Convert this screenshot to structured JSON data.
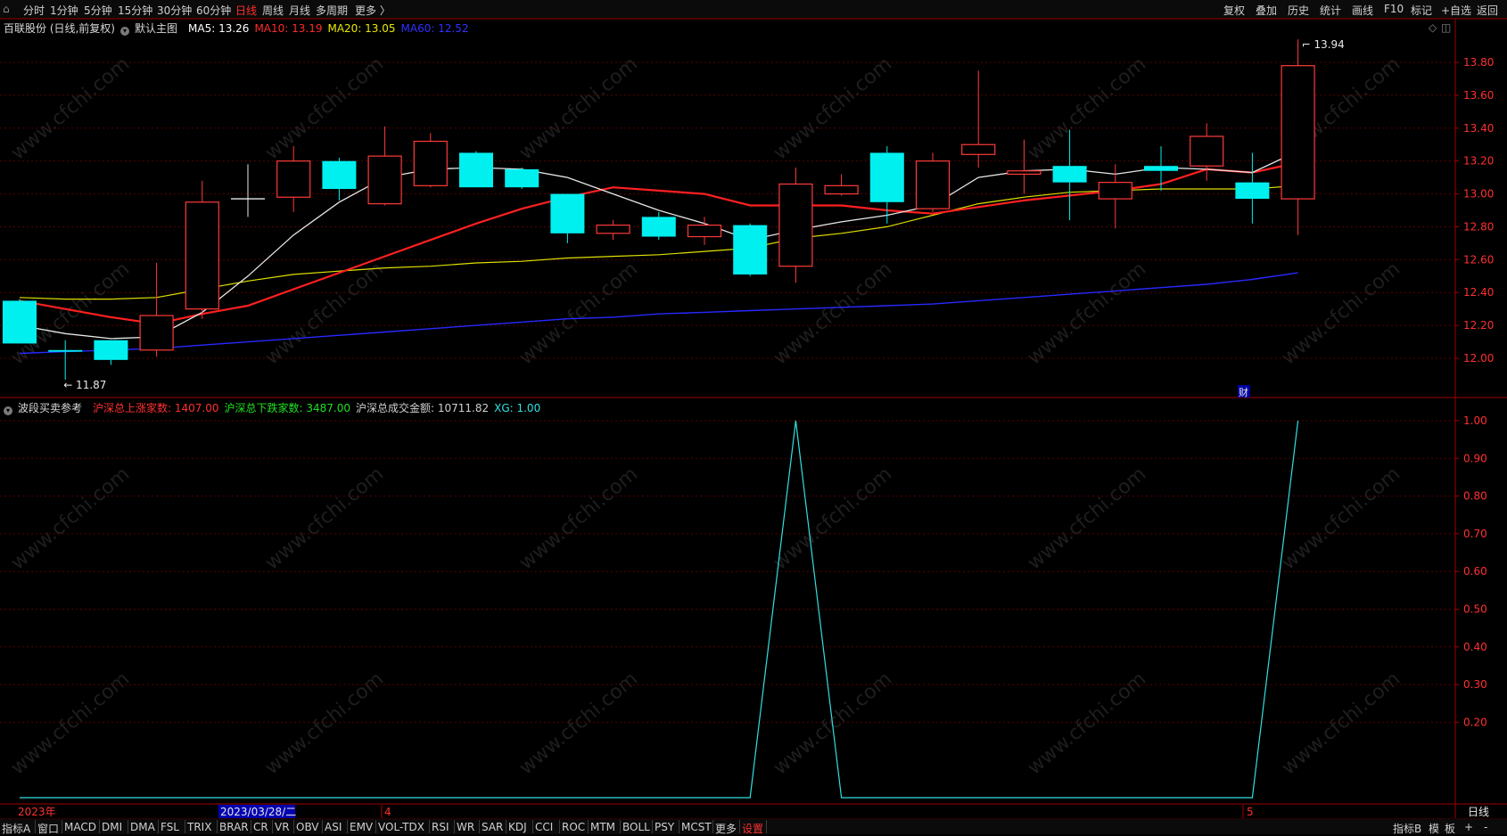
{
  "toolbar": {
    "back_arrow": "⌂",
    "periods": [
      "分时",
      "1分钟",
      "5分钟",
      "15分钟",
      "30分钟",
      "60分钟",
      "日线",
      "周线",
      "月线",
      "多周期",
      "更多 〉"
    ],
    "active_period": "日线",
    "right_tools": [
      "复权",
      "叠加",
      "历史",
      "统计",
      "画线",
      "F10",
      "标记",
      "+自选",
      "返回"
    ]
  },
  "main_panel": {
    "title": "百联股份 (日线,前复权)",
    "template_label": "默认主图",
    "ma_legend": [
      {
        "label": "MA5: 13.26",
        "color": "#ffffff"
      },
      {
        "label": "MA10: 13.19",
        "color": "#ff2a2a"
      },
      {
        "label": "MA20: 13.05",
        "color": "#e8e800"
      },
      {
        "label": "MA60: 12.52",
        "color": "#3030ff"
      }
    ],
    "high_label": "13.94",
    "low_label": "11.87",
    "fin_badge": "财",
    "y_ticks": [
      "13.80",
      "13.60",
      "13.40",
      "13.20",
      "13.00",
      "12.80",
      "12.60",
      "12.40",
      "12.20",
      "12.00"
    ],
    "corner_icons": [
      "◇",
      "◫"
    ]
  },
  "sub_panel": {
    "title": "波段买卖参考",
    "stats": [
      {
        "label": "沪深总上涨家数: 1407.00",
        "color": "#ff3030"
      },
      {
        "label": "沪深总下跌家数: 3487.00",
        "color": "#20e020"
      },
      {
        "label": "沪深总成交金额: 10711.82",
        "color": "#d0d0d0"
      },
      {
        "label": "XG: 1.00",
        "color": "#30e0e0"
      }
    ],
    "y_ticks": [
      "1.00",
      "0.90",
      "0.80",
      "0.70",
      "0.60",
      "0.50",
      "0.40",
      "0.30",
      "0.20"
    ]
  },
  "x_axis": {
    "labels": [
      "2023年",
      "2023/03/28/二",
      "4",
      "5"
    ],
    "cursor_label": "2023/03/28/二",
    "period_label": "日线"
  },
  "watermark": "www.cfchi.com",
  "bottom_bar": {
    "items": [
      "指标A",
      "窗口",
      "MACD",
      "DMI",
      "DMA",
      "FSL",
      "TRIX",
      "BRAR",
      "CR",
      "VR",
      "OBV",
      "ASI",
      "EMV",
      "VOL-TDX",
      "RSI",
      "WR",
      "SAR",
      "KDJ",
      "CCI",
      "ROC",
      "MTM",
      "BOLL",
      "PSY",
      "MCST",
      "更多",
      "设置"
    ],
    "right_items": [
      "指标B",
      "模",
      "板",
      "+",
      "-"
    ]
  },
  "chart_data": [
    {
      "type": "candlestick",
      "y_range": [
        11.8,
        13.95
      ],
      "candles": [
        {
          "o": 12.35,
          "h": 12.36,
          "l": 12.1,
          "c": 12.09
        },
        {
          "o": 12.05,
          "h": 12.11,
          "l": 11.87,
          "c": 12.04
        },
        {
          "o": 12.11,
          "h": 12.11,
          "l": 11.96,
          "c": 11.99
        },
        {
          "o": 12.05,
          "h": 12.58,
          "l": 12.01,
          "c": 12.26
        },
        {
          "o": 12.3,
          "h": 13.08,
          "l": 12.24,
          "c": 12.95
        },
        {
          "o": 12.97,
          "h": 13.18,
          "l": 12.86,
          "c": 12.97
        },
        {
          "o": 12.98,
          "h": 13.29,
          "l": 12.89,
          "c": 13.2
        },
        {
          "o": 13.2,
          "h": 13.22,
          "l": 12.96,
          "c": 13.03
        },
        {
          "o": 12.94,
          "h": 13.41,
          "l": 12.93,
          "c": 13.23
        },
        {
          "o": 13.05,
          "h": 13.37,
          "l": 13.04,
          "c": 13.32
        },
        {
          "o": 13.25,
          "h": 13.26,
          "l": 13.04,
          "c": 13.04
        },
        {
          "o": 13.15,
          "h": 13.16,
          "l": 13.03,
          "c": 13.04
        },
        {
          "o": 13.0,
          "h": 13.0,
          "l": 12.7,
          "c": 12.76
        },
        {
          "o": 12.76,
          "h": 12.84,
          "l": 12.72,
          "c": 12.81
        },
        {
          "o": 12.86,
          "h": 12.89,
          "l": 12.72,
          "c": 12.74
        },
        {
          "o": 12.74,
          "h": 12.86,
          "l": 12.69,
          "c": 12.81
        },
        {
          "o": 12.81,
          "h": 12.82,
          "l": 12.5,
          "c": 12.51
        },
        {
          "o": 12.56,
          "h": 13.16,
          "l": 12.46,
          "c": 13.06
        },
        {
          "o": 13.0,
          "h": 13.12,
          "l": 12.99,
          "c": 13.05
        },
        {
          "o": 13.25,
          "h": 13.29,
          "l": 12.82,
          "c": 12.95
        },
        {
          "o": 12.91,
          "h": 13.25,
          "l": 12.89,
          "c": 13.2
        },
        {
          "o": 13.24,
          "h": 13.75,
          "l": 13.16,
          "c": 13.3
        },
        {
          "o": 13.12,
          "h": 13.33,
          "l": 13.0,
          "c": 13.14
        },
        {
          "o": 13.17,
          "h": 13.39,
          "l": 12.84,
          "c": 13.07
        },
        {
          "o": 12.97,
          "h": 13.18,
          "l": 12.79,
          "c": 13.07
        },
        {
          "o": 13.17,
          "h": 13.29,
          "l": 13.02,
          "c": 13.14
        },
        {
          "o": 13.17,
          "h": 13.43,
          "l": 13.08,
          "c": 13.35
        },
        {
          "o": 13.07,
          "h": 13.25,
          "l": 12.82,
          "c": 12.97
        },
        {
          "o": 12.97,
          "h": 13.94,
          "l": 12.75,
          "c": 13.78
        }
      ],
      "ma5": [
        12.2,
        12.15,
        12.12,
        12.13,
        12.28,
        12.5,
        12.75,
        12.95,
        13.1,
        13.15,
        13.16,
        13.15,
        13.1,
        13.0,
        12.9,
        12.82,
        12.72,
        12.78,
        12.83,
        12.87,
        12.93,
        13.1,
        13.14,
        13.15,
        13.12,
        13.16,
        13.15,
        13.13,
        13.26
      ],
      "ma10": [
        12.35,
        12.3,
        12.25,
        12.21,
        12.27,
        12.32,
        12.42,
        12.52,
        12.62,
        12.72,
        12.82,
        12.91,
        12.98,
        13.04,
        13.02,
        13.0,
        12.93,
        12.93,
        12.93,
        12.9,
        12.88,
        12.92,
        12.96,
        12.99,
        13.02,
        13.06,
        13.15,
        13.13,
        13.19
      ],
      "ma20": [
        12.37,
        12.36,
        12.36,
        12.37,
        12.42,
        12.47,
        12.51,
        12.53,
        12.55,
        12.56,
        12.58,
        12.59,
        12.61,
        12.62,
        12.63,
        12.65,
        12.67,
        12.73,
        12.76,
        12.8,
        12.87,
        12.94,
        12.98,
        13.01,
        13.02,
        13.03,
        13.03,
        13.03,
        13.05
      ],
      "ma60": [
        12.03,
        12.04,
        12.05,
        12.06,
        12.08,
        12.1,
        12.12,
        12.14,
        12.16,
        12.18,
        12.2,
        12.22,
        12.24,
        12.25,
        12.27,
        12.28,
        12.29,
        12.3,
        12.31,
        12.32,
        12.33,
        12.35,
        12.37,
        12.39,
        12.41,
        12.43,
        12.45,
        12.48,
        12.52
      ]
    },
    {
      "type": "line",
      "name": "XG",
      "y_range": [
        0,
        1
      ],
      "x_index": [
        0,
        16,
        17,
        18,
        27,
        28
      ],
      "values": [
        0,
        0,
        1,
        0,
        0,
        1
      ]
    }
  ]
}
